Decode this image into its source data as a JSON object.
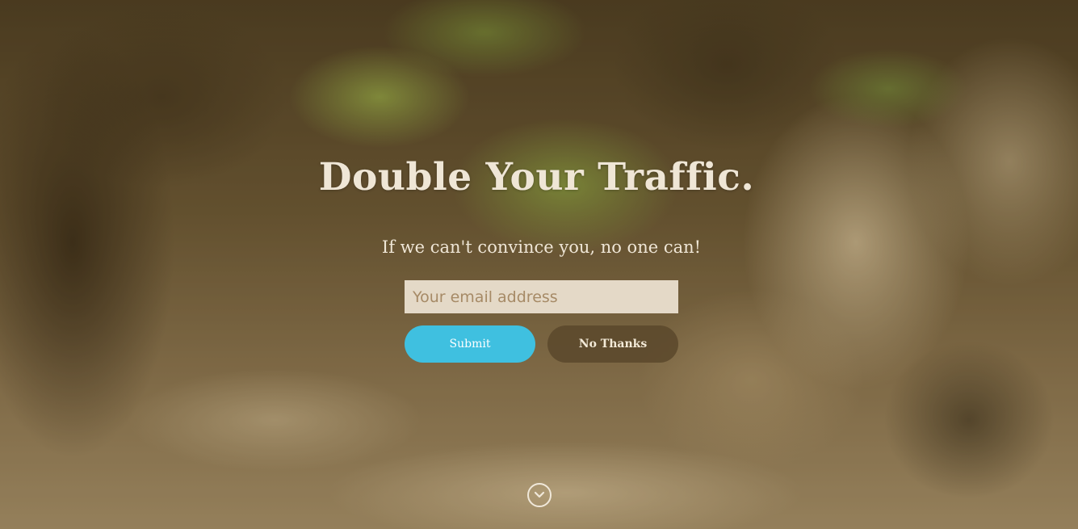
{
  "hero": {
    "headline": "Double Your Traffic.",
    "subheadline": "If we can't convince you, no one can!"
  },
  "form": {
    "email_placeholder": "Your email address",
    "email_value": "",
    "submit_label": "Submit",
    "decline_label": "No Thanks"
  },
  "scroll": {
    "icon": "chevron-down-circle-icon"
  },
  "colors": {
    "submit_button": "#3fc0e0",
    "decline_button": "#5a482c",
    "text": "#efe6d6"
  }
}
